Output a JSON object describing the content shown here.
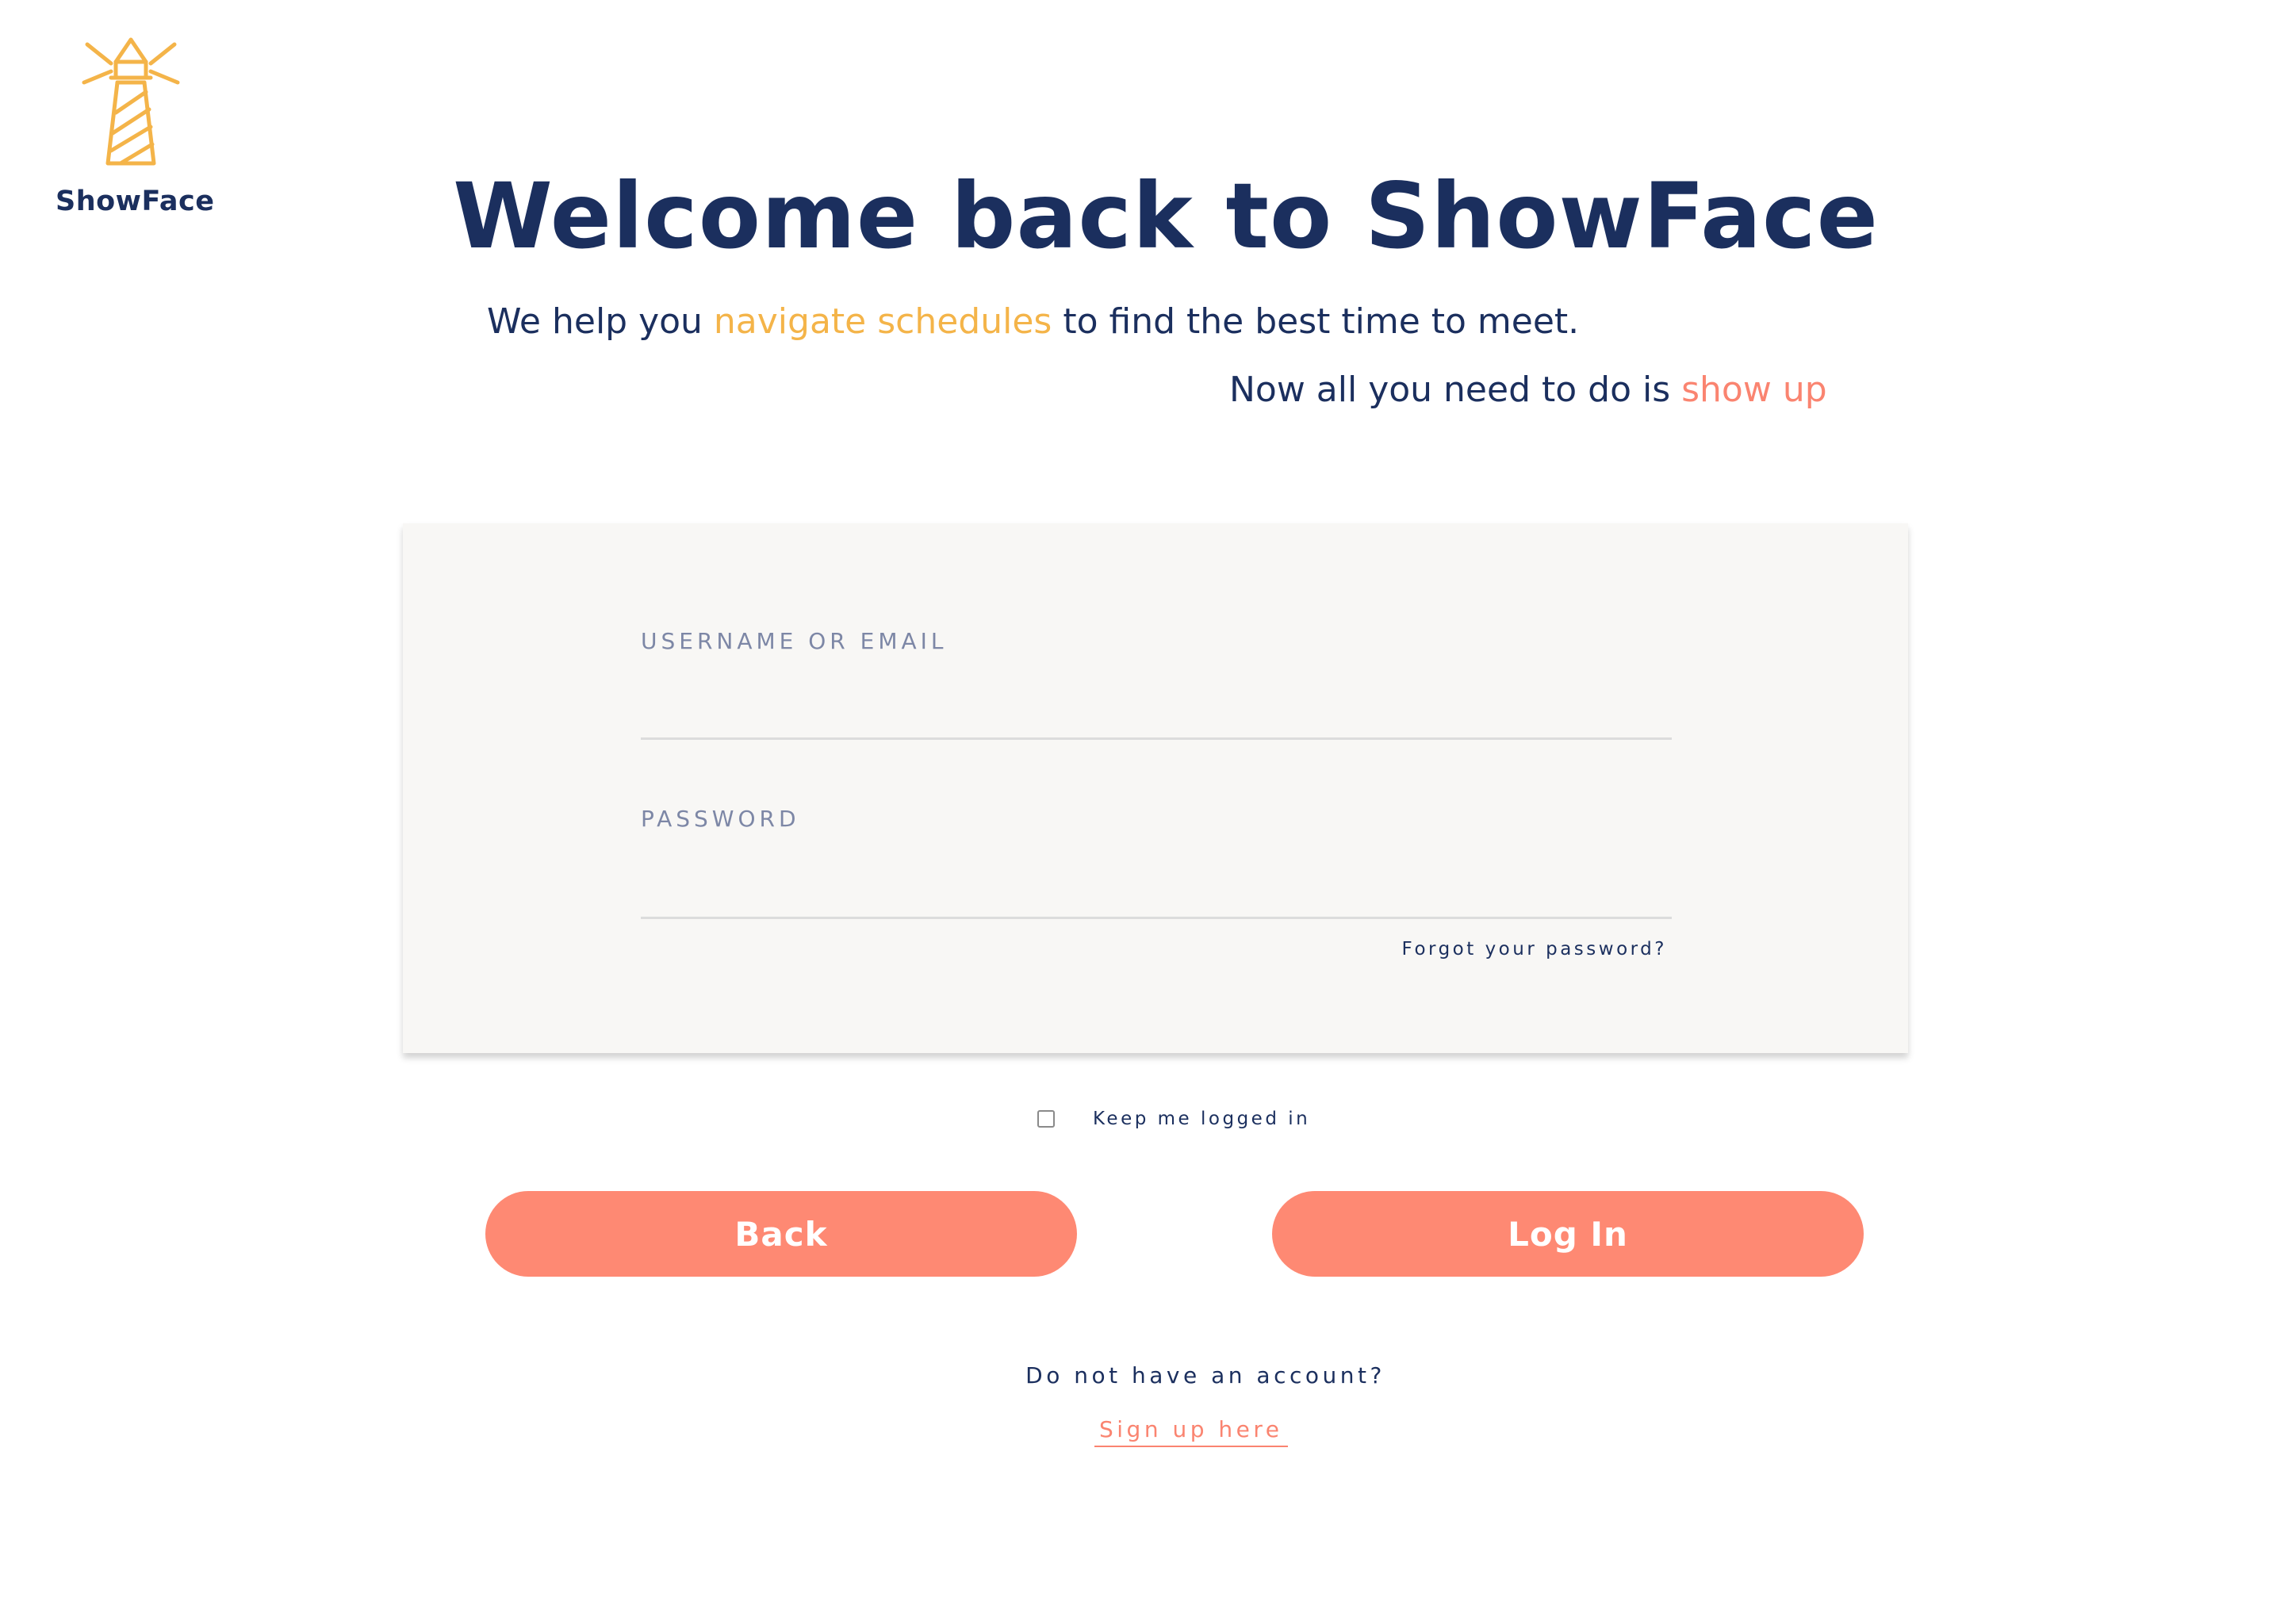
{
  "brand": {
    "name": "ShowFace",
    "logo_icon": "lighthouse-icon",
    "colors": {
      "navy": "#1b2f5e",
      "yellow": "#f4b449",
      "coral": "#fa8470",
      "card_bg": "#f8f7f5"
    }
  },
  "header": {
    "title": "Welcome back to ShowFace",
    "tagline_1": {
      "before": "We help you ",
      "highlight": "navigate schedules",
      "after": " to find the best time to meet."
    },
    "tagline_2": {
      "before": "Now all you need to do is ",
      "highlight": "show up"
    }
  },
  "form": {
    "username_label": "USERNAME OR EMAIL",
    "username_value": "",
    "password_label": "PASSWORD",
    "password_value": "",
    "forgot_link": "Forgot your password?",
    "keep_logged_in_label": "Keep me logged in",
    "keep_logged_in_checked": false
  },
  "actions": {
    "back_label": "Back",
    "login_label": "Log In"
  },
  "signup": {
    "prompt": "Do not have an account?",
    "link": "Sign up here"
  }
}
